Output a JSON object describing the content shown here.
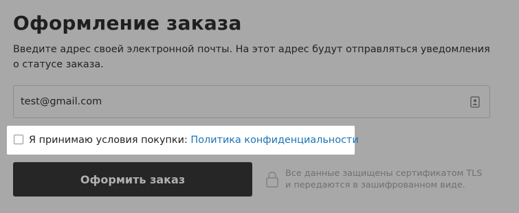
{
  "page": {
    "title": "Оформление заказа",
    "description": "Введите адрес своей электронной почты. На этот адрес будут отправляться уведомления о статусе заказа."
  },
  "email": {
    "value": "test@gmail.com",
    "icon": "contact-card-icon"
  },
  "consent": {
    "checked": false,
    "text": "Я принимаю условия покупки: ",
    "link_label": "Политика конфиденциальности"
  },
  "submit": {
    "label": "Оформить заказ"
  },
  "security": {
    "icon": "lock-icon",
    "line1": "Все данные защищены сертификатом TLS",
    "line2": "и передаются в зашифрованном виде."
  },
  "colors": {
    "overlay_background": "#a8a8a8",
    "button_background": "#262626",
    "link": "#1a73b5",
    "highlight": "#ffffff"
  }
}
